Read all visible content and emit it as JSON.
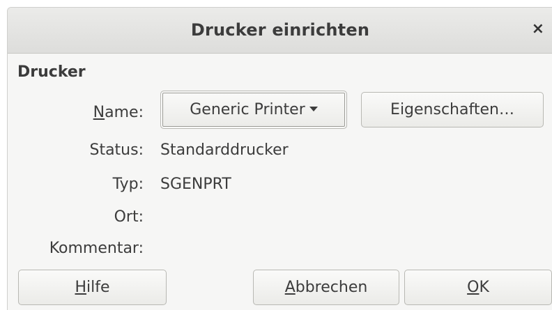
{
  "dialog": {
    "title": "Drucker einrichten",
    "close_glyph": "×"
  },
  "printer_section": {
    "heading": "Drucker",
    "name": {
      "label_mnemonic": "N",
      "label_rest": "ame:",
      "selected": "Generic Printer",
      "dropdown_icon": "chevron-down-icon"
    },
    "properties_button": "Eigenschaften…",
    "status": {
      "label": "Status:",
      "value": "Standarddrucker"
    },
    "type": {
      "label": "Typ:",
      "value": "SGENPRT"
    },
    "location": {
      "label": "Ort:",
      "value": ""
    },
    "comment": {
      "label": "Kommentar:",
      "value": ""
    }
  },
  "buttons": {
    "help": {
      "mnemonic": "H",
      "rest": "ilfe"
    },
    "cancel": {
      "mnemonic": "A",
      "rest": "bbrechen"
    },
    "ok": {
      "mnemonic": "O",
      "rest": "K"
    }
  }
}
